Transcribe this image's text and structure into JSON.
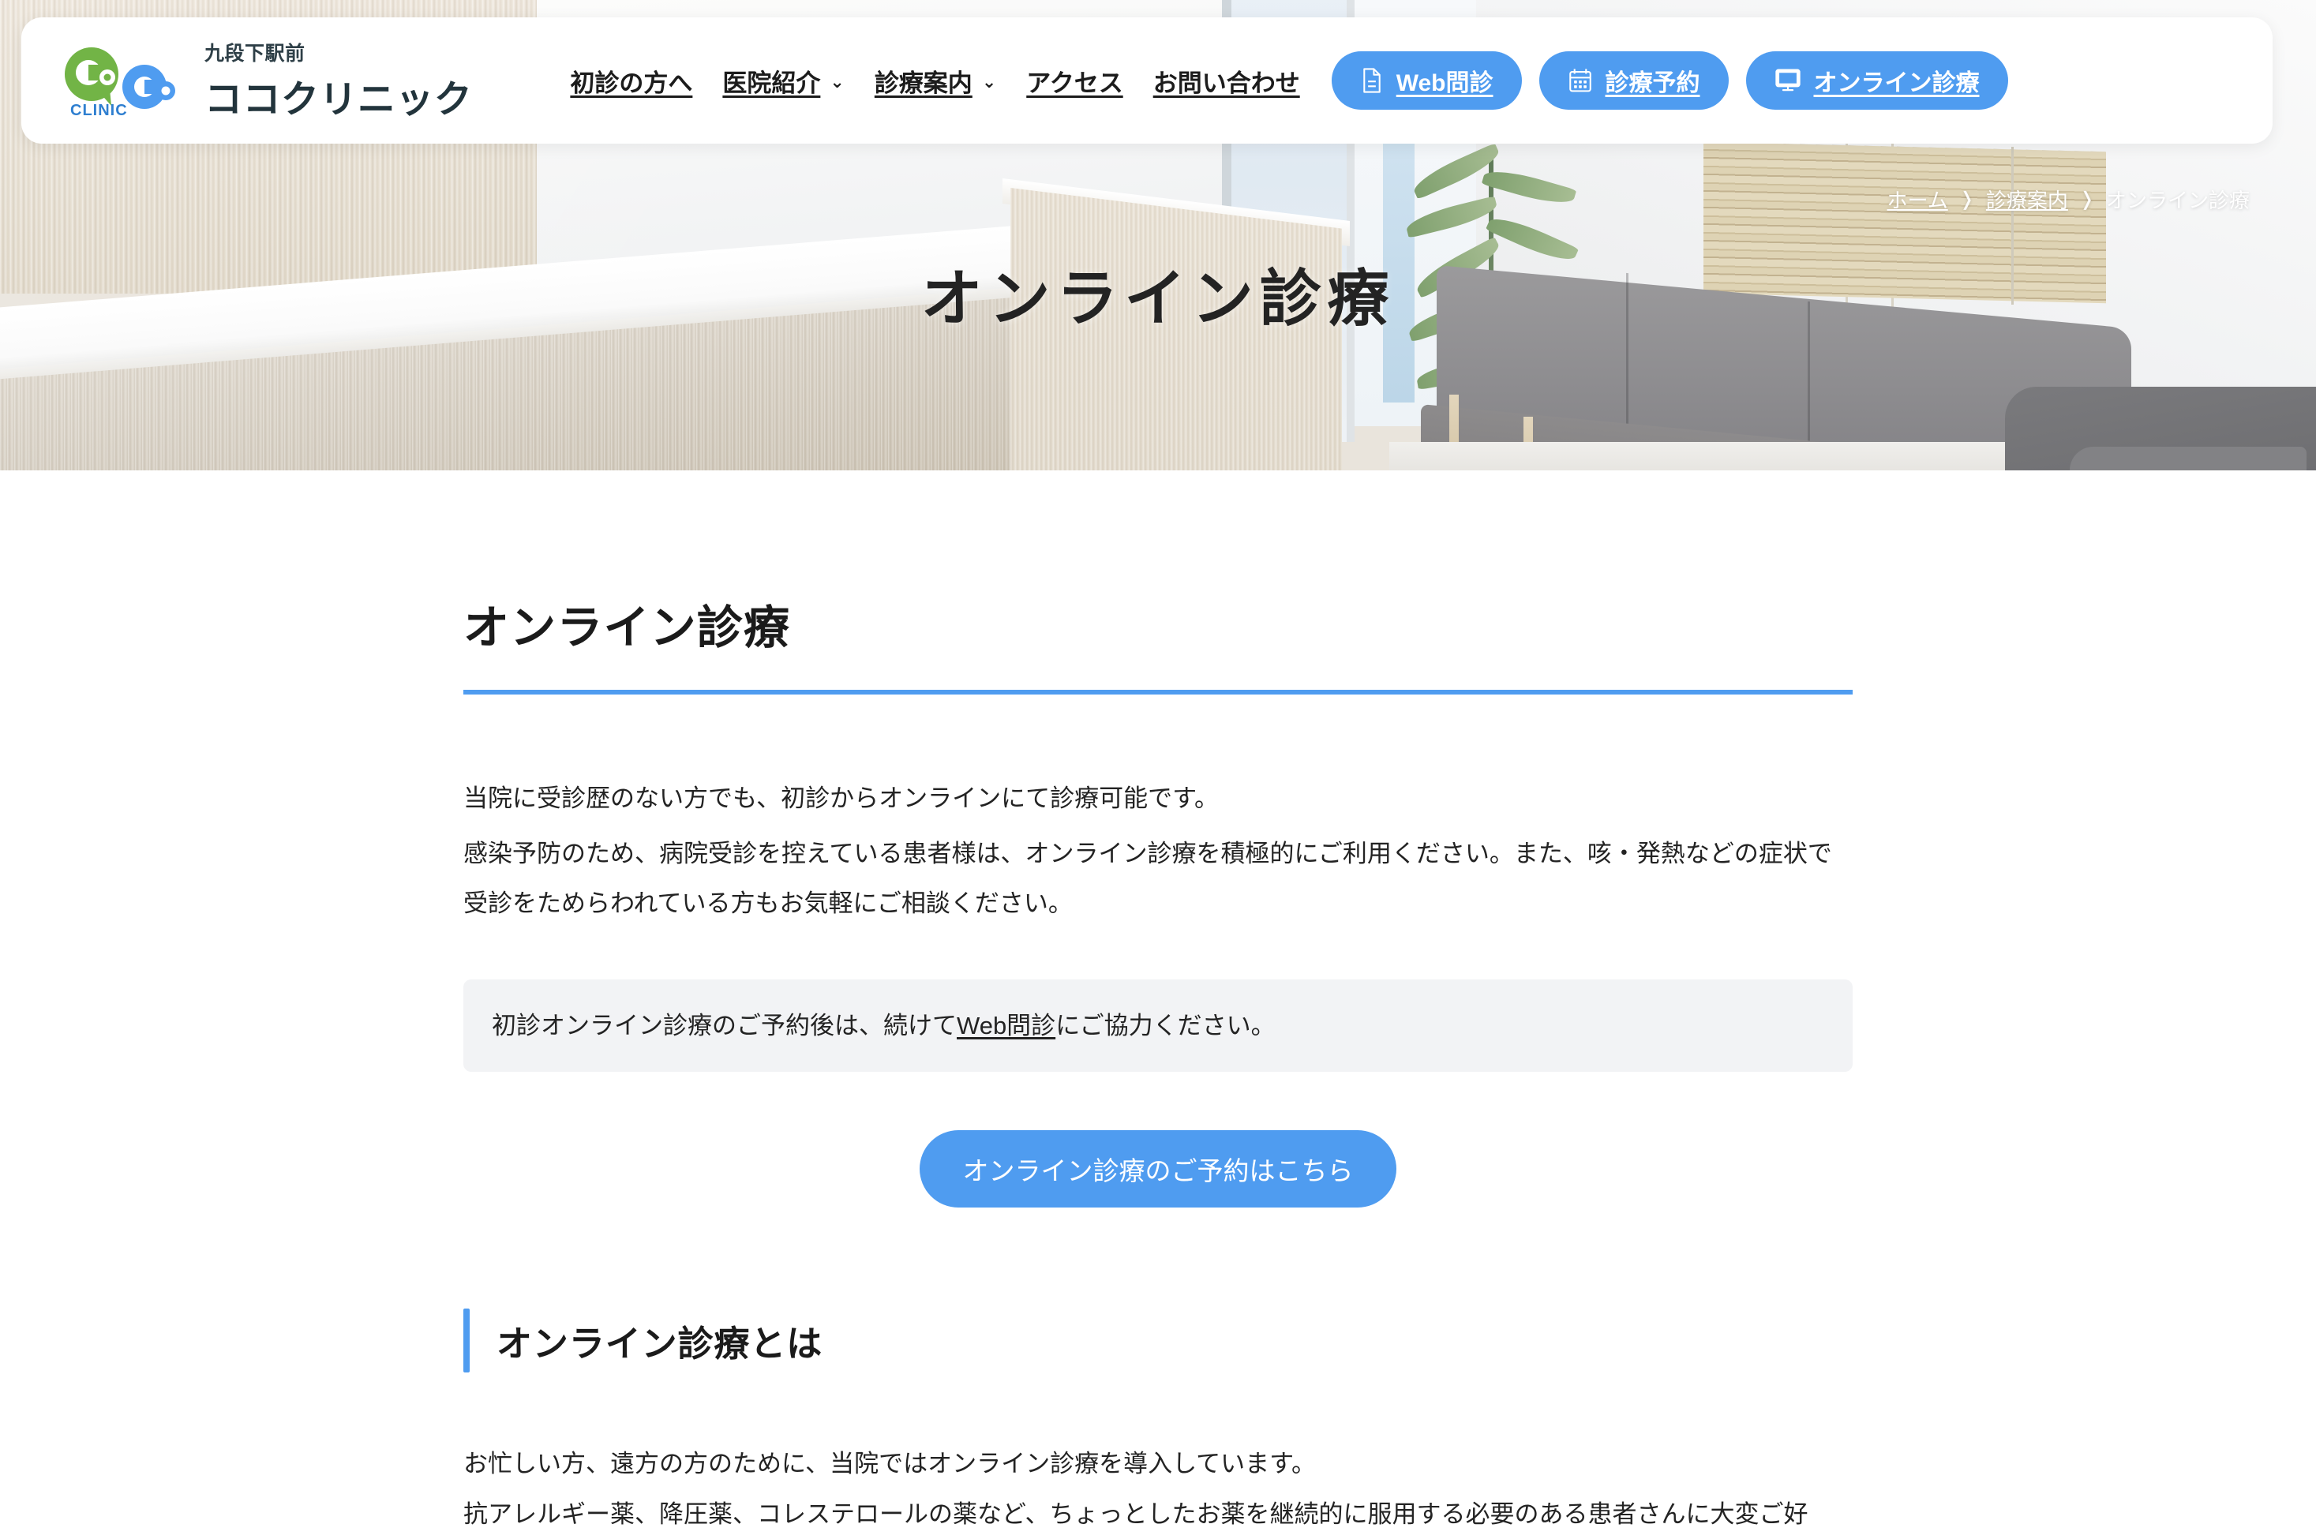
{
  "header": {
    "logo_icon": "coco-clinic-logo",
    "logo_caption": "CLINIC",
    "brand_sub": "九段下駅前",
    "brand_name": "ココクリニック",
    "nav": [
      {
        "label": "初診の方へ",
        "has_caret": false,
        "name": "nav-first-visit"
      },
      {
        "label": "医院紹介",
        "has_caret": true,
        "caret": "⌄",
        "name": "nav-clinic-intro"
      },
      {
        "label": "診療案内",
        "has_caret": true,
        "caret": "⌄",
        "name": "nav-medical-guide"
      },
      {
        "label": "アクセス",
        "has_caret": false,
        "name": "nav-access"
      },
      {
        "label": "お問い合わせ",
        "has_caret": false,
        "name": "nav-contact"
      }
    ],
    "ctas": [
      {
        "label": "Web問診",
        "icon": "document-icon",
        "name": "web-questionnaire-button"
      },
      {
        "label": "診療予約",
        "icon": "calendar-icon",
        "name": "appointment-button"
      },
      {
        "label": "オンライン診療",
        "icon": "monitor-icon",
        "name": "online-consultation-button"
      }
    ]
  },
  "hero": {
    "title": "オンライン診療",
    "breadcrumb": [
      {
        "label": "ホーム",
        "link": true
      },
      {
        "label": "診療案内",
        "link": true
      },
      {
        "label": "オンライン診療",
        "link": false
      }
    ],
    "breadcrumb_separator": "❭"
  },
  "main": {
    "page_title": "オンライン診療",
    "lead": [
      "当院に受診歴のない方でも、初診からオンラインにて診療可能です。",
      "感染予防のため、病院受診を控えている患者様は、オンライン診療を積極的にご利用ください。また、咳・発熱などの症状で受診をためらわれている方もお気軽にご相談ください。"
    ],
    "notice": {
      "before": "初診オンライン診療のご予約後は、続けて",
      "link": "Web問診",
      "after": "にご協力ください。"
    },
    "cta_big": "オンライン診療のご予約はこちら",
    "section_heading": "オンライン診療とは",
    "body": [
      "お忙しい方、遠方の方のために、当院ではオンライン診療を導入しています。",
      "抗アレルギー薬、降圧薬、コレステロールの薬など、ちょっとしたお薬を継続的に服用する必要のある患者さんに大変ご好"
    ]
  },
  "colors": {
    "accent_blue": "#4f9cf0",
    "logo_green": "#72b446",
    "logo_blue": "#4f9cf0",
    "text_dark": "#232323",
    "notice_bg": "#f2f3f5"
  }
}
